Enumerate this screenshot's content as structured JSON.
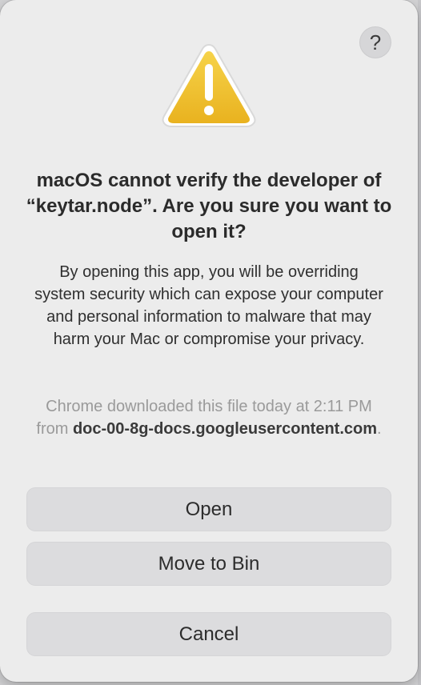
{
  "dialog": {
    "help_label": "?",
    "title": "macOS cannot verify the developer of “keytar.node”. Are you sure you want to open it?",
    "body": "By opening this app, you will be overriding system security which can expose your computer and personal information to malware that may harm your Mac or compromise your privacy.",
    "source_prefix": "Chrome downloaded this file today at 2:11 PM from ",
    "source_host": "doc-00-8g-docs.googleusercontent.com",
    "source_suffix": ".",
    "icon": "warning-triangle-icon",
    "buttons": {
      "open": "Open",
      "move_to_bin": "Move to Bin",
      "cancel": "Cancel"
    },
    "colors": {
      "warning_fill": "#f3c534",
      "dialog_bg": "#ececec",
      "button_bg": "#dcdcde"
    }
  }
}
